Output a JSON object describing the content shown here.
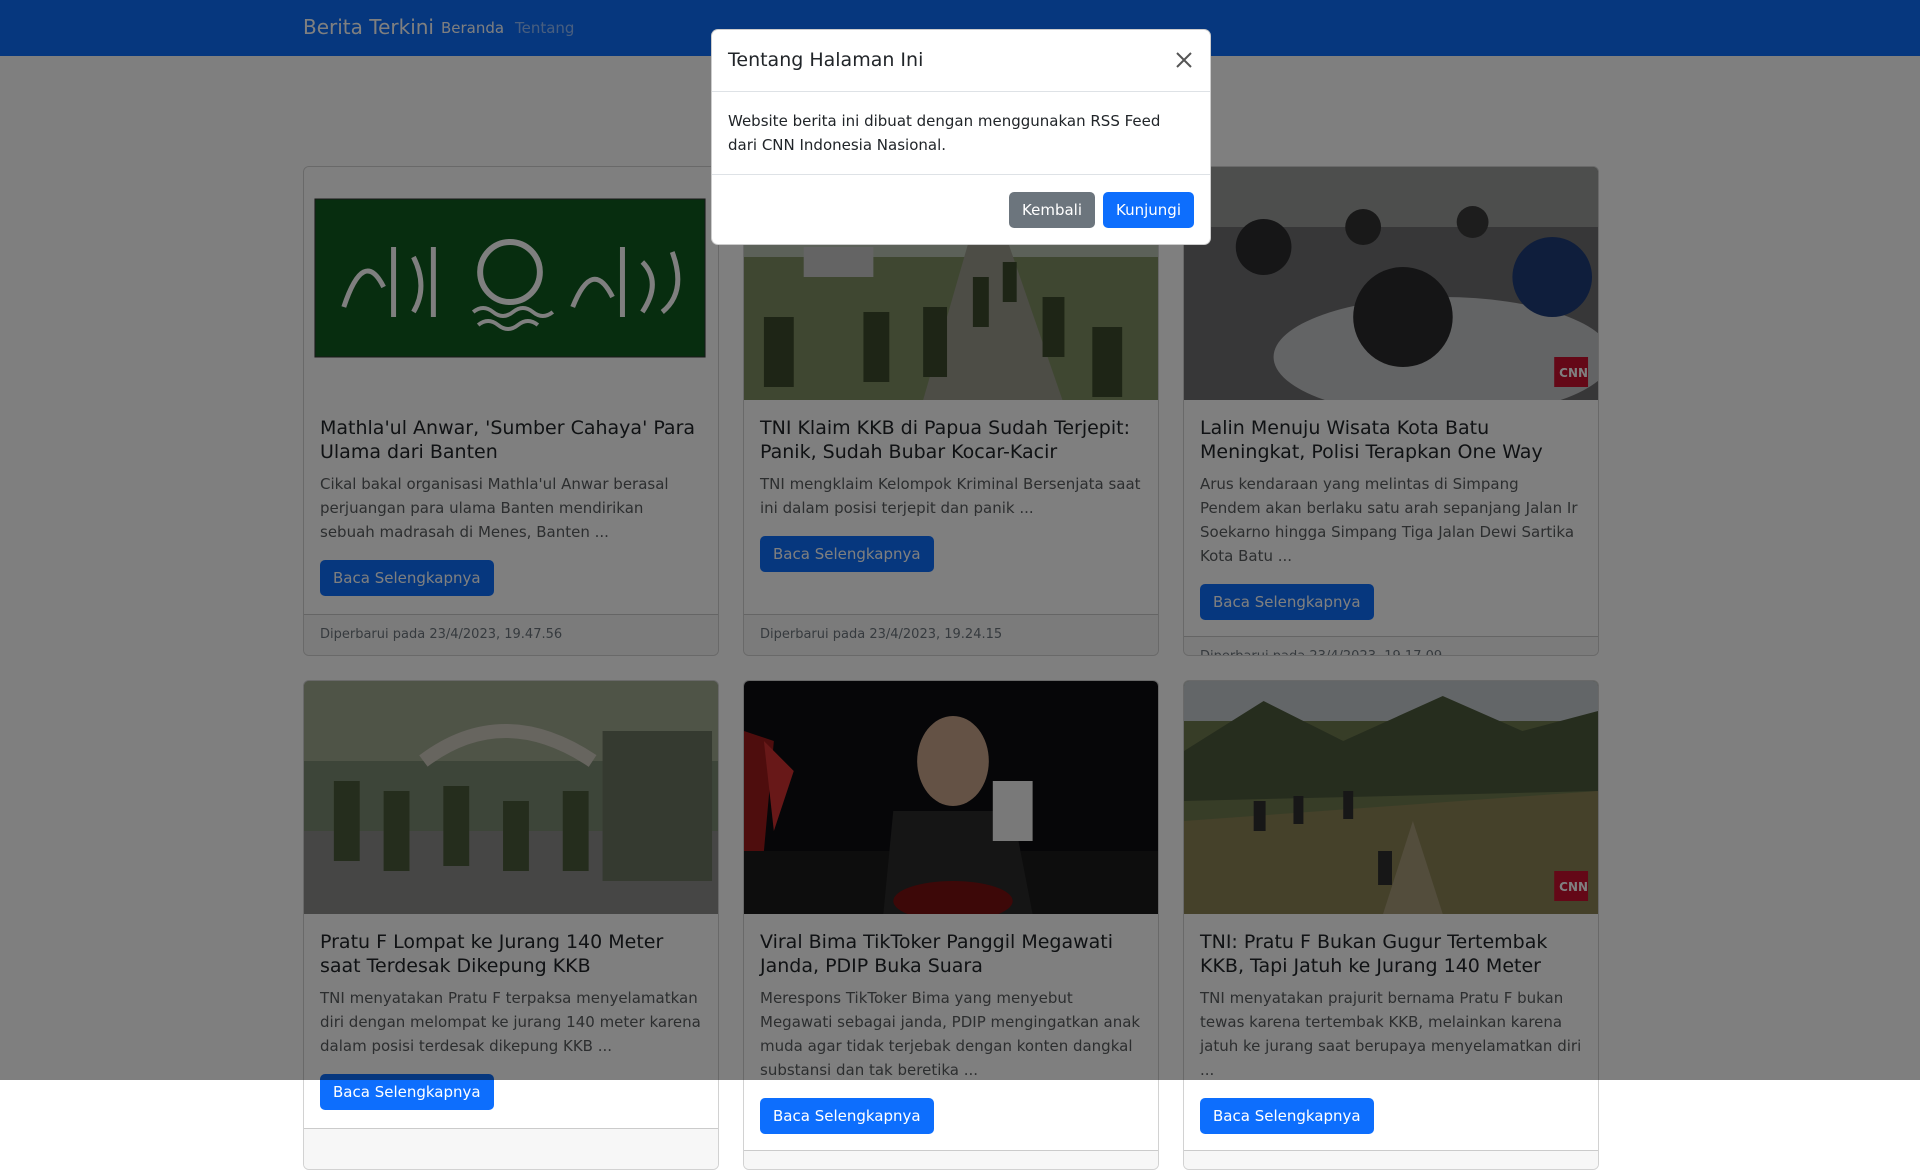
{
  "navbar": {
    "brand": "Berita Terkini",
    "links": [
      {
        "label": "Beranda"
      },
      {
        "label": "Tentang"
      }
    ]
  },
  "cards": [
    {
      "title": "Mathla'ul Anwar, 'Sumber Cahaya' Para Ulama dari Banten",
      "excerpt": "Cikal bakal organisasi Mathla'ul Anwar berasal perjuangan para ulama Banten mendirikan sebuah madrasah di Menes, Banten ...",
      "button": "Baca Selengkapnya",
      "updated": "Diperbarui pada 23/4/2023, 19.47.56"
    },
    {
      "title": "TNI Klaim KKB di Papua Sudah Terjepit: Panik, Sudah Bubar Kocar-Kacir",
      "excerpt": "TNI mengklaim Kelompok Kriminal Bersenjata saat ini dalam posisi terjepit dan panik ...",
      "button": "Baca Selengkapnya",
      "updated": "Diperbarui pada 23/4/2023, 19.24.15"
    },
    {
      "title": "Lalin Menuju Wisata Kota Batu Meningkat, Polisi Terapkan One Way",
      "excerpt": "Arus kendaraan yang melintas di Simpang Pendem akan berlaku satu arah sepanjang Jalan Ir Soekarno hingga Simpang Tiga Jalan Dewi Sartika Kota Batu ...",
      "button": "Baca Selengkapnya",
      "updated": "Diperbarui pada 23/4/2023, 19.17.09"
    },
    {
      "title": "Pratu F Lompat ke Jurang 140 Meter saat Terdesak Dikepung KKB",
      "excerpt": "TNI menyatakan Pratu F terpaksa menyelamatkan diri dengan melompat ke jurang 140 meter karena dalam posisi terdesak dikepung KKB ...",
      "button": "Baca Selengkapnya",
      "updated": ""
    },
    {
      "title": "Viral Bima TikToker Panggil Megawati Janda, PDIP Buka Suara",
      "excerpt": "Merespons TikToker Bima yang menyebut Megawati sebagai janda, PDIP mengingatkan anak muda agar tidak terjebak dengan konten dangkal substansi dan tak beretika ...",
      "button": "Baca Selengkapnya",
      "updated": ""
    },
    {
      "title": "TNI: Pratu F Bukan Gugur Tertembak KKB, Tapi Jatuh ke Jurang 140 Meter",
      "excerpt": "TNI menyatakan prajurit bernama Pratu F bukan tewas karena tertembak KKB, melainkan karena jatuh ke jurang saat berupaya menyelamatkan diri ...",
      "button": "Baca Selengkapnya",
      "updated": ""
    }
  ],
  "modal": {
    "title": "Tentang Halaman Ini",
    "body": "Website berita ini dibuat dengan menggunakan RSS Feed dari CNN Indonesia Nasional.",
    "cancel": "Kembali",
    "confirm": "Kunjungi"
  },
  "colors": {
    "primary": "#0d6efd",
    "secondary": "#6c757d",
    "backdrop": "rgba(0,0,0,0.5)"
  }
}
